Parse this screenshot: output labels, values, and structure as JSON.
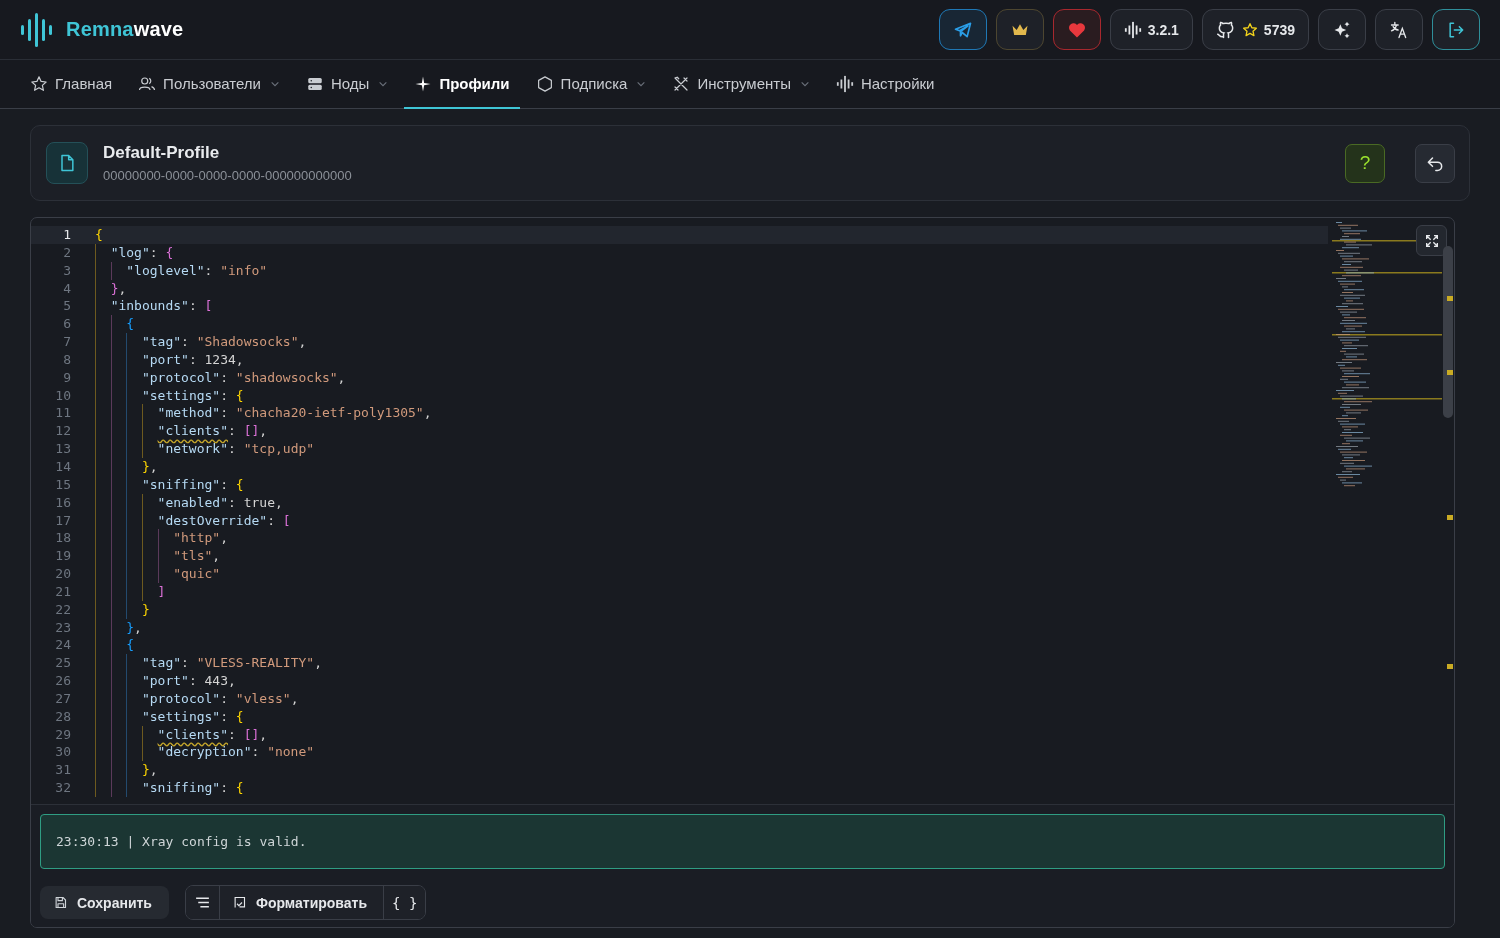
{
  "header": {
    "logo": {
      "part1": "Remna",
      "part2": "wave"
    },
    "actions": [
      {
        "kind": "telegram"
      },
      {
        "kind": "crown"
      },
      {
        "kind": "heart"
      },
      {
        "kind": "version",
        "label": "3.2.1"
      },
      {
        "kind": "github",
        "label": "5739"
      },
      {
        "kind": "sparkle"
      },
      {
        "kind": "translate"
      },
      {
        "kind": "logout"
      }
    ]
  },
  "nav": [
    {
      "label": "Главная",
      "kind": "star",
      "dropdown": false,
      "selected": false
    },
    {
      "label": "Пользователи",
      "kind": "users",
      "dropdown": true,
      "selected": false
    },
    {
      "label": "Ноды",
      "kind": "server",
      "dropdown": true,
      "selected": false
    },
    {
      "label": "Профили",
      "kind": "spark",
      "dropdown": false,
      "selected": true
    },
    {
      "label": "Подписка",
      "kind": "hexagon",
      "dropdown": true,
      "selected": false
    },
    {
      "label": "Инструменты",
      "kind": "tools",
      "dropdown": true,
      "selected": false
    },
    {
      "label": "Настройки",
      "kind": "wave",
      "dropdown": false,
      "selected": false
    }
  ],
  "profile": {
    "name": "Default-Profile",
    "uuid": "00000000-0000-0000-0000-000000000000",
    "help": "?"
  },
  "editor": {
    "lines": [
      {
        "n": "1",
        "text": "{",
        "warning": false,
        "current": true
      },
      {
        "n": "2",
        "text": "  \"log\": {",
        "warning": false,
        "current": false
      },
      {
        "n": "3",
        "text": "    \"loglevel\": \"info\"",
        "warning": false,
        "current": false
      },
      {
        "n": "4",
        "text": "  },",
        "warning": false,
        "current": false
      },
      {
        "n": "5",
        "text": "  \"inbounds\": [",
        "warning": false,
        "current": false
      },
      {
        "n": "6",
        "text": "    {",
        "warning": false,
        "current": false
      },
      {
        "n": "7",
        "text": "      \"tag\": \"Shadowsocks\",",
        "warning": false,
        "current": false
      },
      {
        "n": "8",
        "text": "      \"port\": 1234,",
        "warning": false,
        "current": false
      },
      {
        "n": "9",
        "text": "      \"protocol\": \"shadowsocks\",",
        "warning": false,
        "current": false
      },
      {
        "n": "10",
        "text": "      \"settings\": {",
        "warning": false,
        "current": false
      },
      {
        "n": "11",
        "text": "        \"method\": \"chacha20-ietf-poly1305\",",
        "warning": false,
        "current": false
      },
      {
        "n": "12",
        "text": "        \"clients\": [],",
        "warning": true,
        "current": false
      },
      {
        "n": "13",
        "text": "        \"network\": \"tcp,udp\"",
        "warning": false,
        "current": false
      },
      {
        "n": "14",
        "text": "      },",
        "warning": false,
        "current": false
      },
      {
        "n": "15",
        "text": "      \"sniffing\": {",
        "warning": false,
        "current": false
      },
      {
        "n": "16",
        "text": "        \"enabled\": true,",
        "warning": false,
        "current": false
      },
      {
        "n": "17",
        "text": "        \"destOverride\": [",
        "warning": false,
        "current": false
      },
      {
        "n": "18",
        "text": "          \"http\",",
        "warning": false,
        "current": false
      },
      {
        "n": "19",
        "text": "          \"tls\",",
        "warning": false,
        "current": false
      },
      {
        "n": "20",
        "text": "          \"quic\"",
        "warning": false,
        "current": false
      },
      {
        "n": "21",
        "text": "        ]",
        "warning": false,
        "current": false
      },
      {
        "n": "22",
        "text": "      }",
        "warning": false,
        "current": false
      },
      {
        "n": "23",
        "text": "    },",
        "warning": false,
        "current": false
      },
      {
        "n": "24",
        "text": "    {",
        "warning": false,
        "current": false
      },
      {
        "n": "25",
        "text": "      \"tag\": \"VLESS-REALITY\",",
        "warning": false,
        "current": false
      },
      {
        "n": "26",
        "text": "      \"port\": 443,",
        "warning": false,
        "current": false
      },
      {
        "n": "27",
        "text": "      \"protocol\": \"vless\",",
        "warning": false,
        "current": false
      },
      {
        "n": "28",
        "text": "      \"settings\": {",
        "warning": false,
        "current": false
      },
      {
        "n": "29",
        "text": "        \"clients\": [],",
        "warning": true,
        "current": false
      },
      {
        "n": "30",
        "text": "        \"decryption\": \"none\"",
        "warning": false,
        "current": false
      },
      {
        "n": "31",
        "text": "      },",
        "warning": false,
        "current": false
      },
      {
        "n": "32",
        "text": "      \"sniffing\": {",
        "warning": false,
        "current": false
      }
    ]
  },
  "status": {
    "message": "23:30:13 | Xray config is valid."
  },
  "toolbar": {
    "save": "Сохранить",
    "format": "Форматировать",
    "braces": "{ }"
  }
}
